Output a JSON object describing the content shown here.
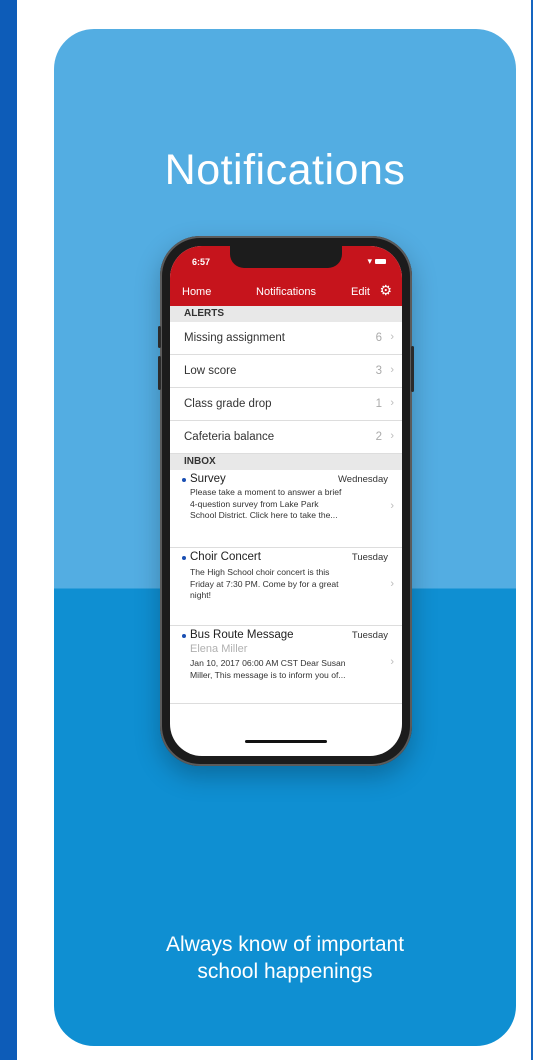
{
  "hero": {
    "title": "Notifications",
    "tagline_line1": "Always know of important",
    "tagline_line2": "school happenings"
  },
  "phone": {
    "status_time": "6:57",
    "nav": {
      "home": "Home",
      "title": "Notifications",
      "edit": "Edit",
      "settings_icon": "gear-icon"
    },
    "alerts_header": "ALERTS",
    "alerts": [
      {
        "label": "Missing assignment",
        "count": "6"
      },
      {
        "label": "Low score",
        "count": "3"
      },
      {
        "label": "Class grade drop",
        "count": "1"
      },
      {
        "label": "Cafeteria balance",
        "count": "2"
      }
    ],
    "inbox_header": "INBOX",
    "inbox": [
      {
        "title": "Survey",
        "date": "Wednesday",
        "sender": "",
        "body1": "Please take a moment to answer a brief",
        "body2": "4-question survey from Lake Park",
        "body3": "School District.    Click here to take the..."
      },
      {
        "title": "Choir Concert",
        "date": "Tuesday",
        "sender": "",
        "body1": "The High School choir concert is this",
        "body2": "Friday at 7:30 PM. Come by for a great",
        "body3": "night!"
      },
      {
        "title": "Bus Route Message",
        "date": "Tuesday",
        "sender": "Elena Miller",
        "body1": "Jan 10, 2017 06:00 AM CST Dear Susan",
        "body2": "Miller, This message is to inform you of...",
        "body3": ""
      }
    ]
  },
  "colors": {
    "card_light": "#53ade2",
    "card_dark": "#0f8fd2",
    "app_red": "#c6141c",
    "unread_dot": "#1a4fb3"
  }
}
